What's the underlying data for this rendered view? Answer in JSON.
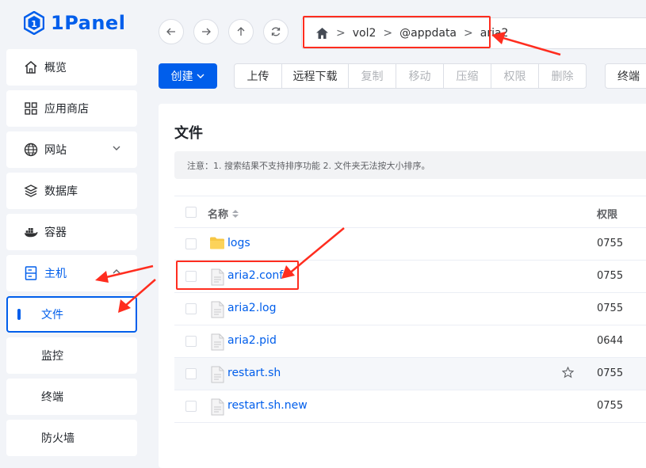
{
  "app": {
    "logo_text": "1Panel"
  },
  "sidebar": {
    "items": [
      {
        "label": "概览",
        "icon": "home-icon"
      },
      {
        "label": "应用商店",
        "icon": "grid-icon"
      },
      {
        "label": "网站",
        "icon": "globe-icon"
      },
      {
        "label": "数据库",
        "icon": "database-icon"
      },
      {
        "label": "容器",
        "icon": "docker-icon"
      },
      {
        "label": "主机",
        "icon": "server-icon"
      }
    ],
    "subitems": [
      {
        "label": "文件"
      },
      {
        "label": "监控"
      },
      {
        "label": "终端"
      },
      {
        "label": "防火墙"
      }
    ]
  },
  "path": {
    "segments": [
      "vol2",
      "@appdata",
      "aria2"
    ],
    "separator": ">"
  },
  "toolbar": {
    "create_label": "创建",
    "buttons": [
      "上传",
      "远程下载",
      "复制",
      "移动",
      "压缩",
      "权限",
      "删除"
    ],
    "terminal_label": "终端"
  },
  "files": {
    "title": "文件",
    "notice": "注意：1. 搜索结果不支持排序功能 2. 文件夹无法按大小排序。",
    "columns": {
      "name": "名称",
      "permission": "权限"
    },
    "rows": [
      {
        "name": "logs",
        "type": "folder",
        "permission": "0755"
      },
      {
        "name": "aria2.conf",
        "type": "file",
        "permission": "0755"
      },
      {
        "name": "aria2.log",
        "type": "file",
        "permission": "0755"
      },
      {
        "name": "aria2.pid",
        "type": "file",
        "permission": "0644"
      },
      {
        "name": "restart.sh",
        "type": "file",
        "permission": "0755"
      },
      {
        "name": "restart.sh.new",
        "type": "file",
        "permission": "0755"
      }
    ]
  },
  "colors": {
    "accent": "#005eeb",
    "annotation": "#ff2d1f",
    "folder": "#f7c744"
  }
}
